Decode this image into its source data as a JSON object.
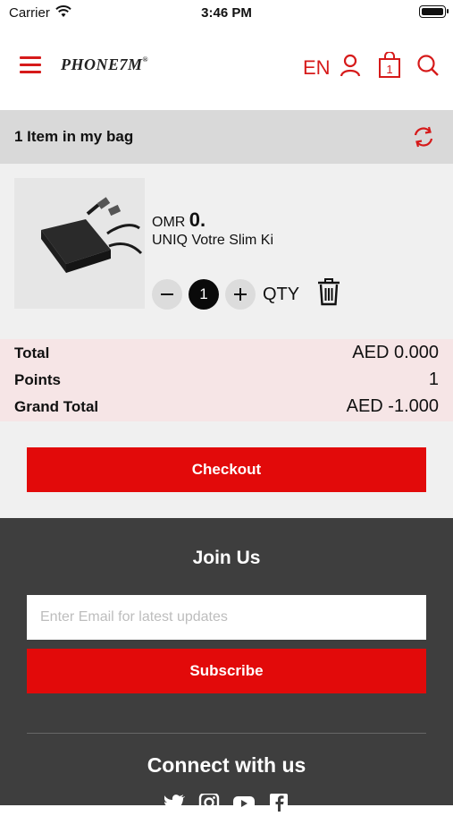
{
  "status_bar": {
    "carrier": "Carrier",
    "time": "3:46 PM"
  },
  "header": {
    "logo_text": "PHONE7M",
    "language": "EN",
    "cart_count": "1"
  },
  "bag": {
    "title": "1  Item in my bag"
  },
  "item": {
    "currency": "OMR",
    "price": "0.",
    "name": "UNIQ Votre Slim Ki",
    "quantity": "1",
    "qty_label": "QTY"
  },
  "totals": {
    "total_label": "Total",
    "total_value": "AED 0.000",
    "points_label": "Points",
    "points_value": "1",
    "grand_label": "Grand Total",
    "grand_value": "AED -1.000"
  },
  "checkout": {
    "label": "Checkout"
  },
  "footer": {
    "join_title": "Join Us",
    "email_placeholder": "Enter Email for latest updates",
    "subscribe_label": "Subscribe",
    "connect_title": "Connect with us"
  },
  "icons": {
    "accent_color": "#d61a1a",
    "button_color": "#e20a0a",
    "social": [
      "twitter-icon",
      "instagram-icon",
      "youtube-icon",
      "facebook-icon"
    ]
  }
}
